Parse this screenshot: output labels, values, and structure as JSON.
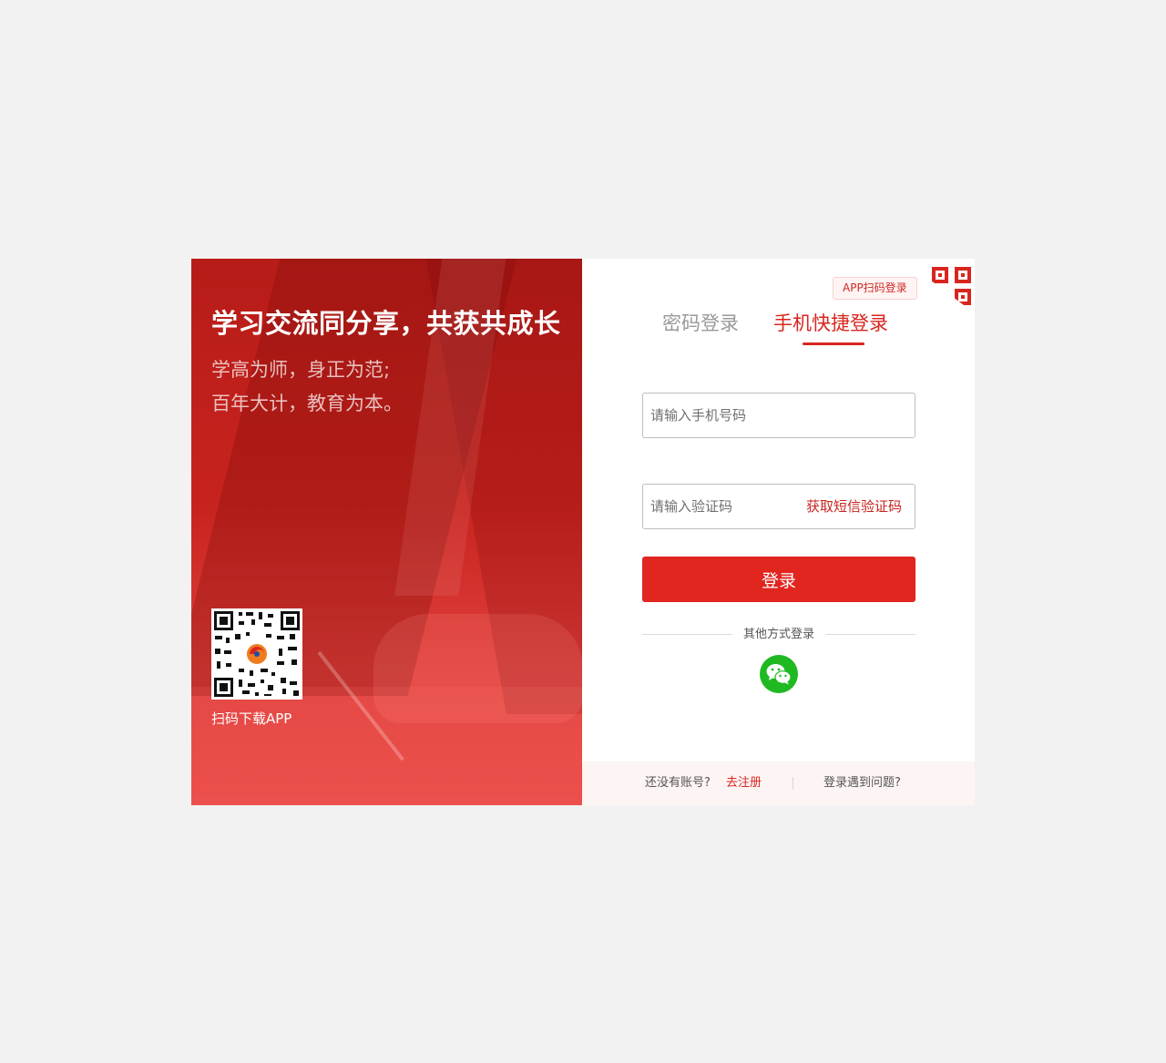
{
  "left_panel": {
    "slogan": "学习交流同分享，共获共成长",
    "motto_line1": "学高为师，身正为范;",
    "motto_line2": "百年大计，教育为本。",
    "qr_caption": "扫码下载APP"
  },
  "login": {
    "app_scan_label": "APP扫码登录",
    "tabs": [
      {
        "label": "密码登录",
        "active": false
      },
      {
        "label": "手机快捷登录",
        "active": true
      }
    ],
    "phone_placeholder": "请输入手机号码",
    "code_placeholder": "请输入验证码",
    "get_code_label": "获取短信验证码",
    "submit_label": "登录",
    "other_methods_label": "其他方式登录",
    "wechat_icon": "wechat-icon"
  },
  "footer": {
    "no_account_text": "还没有账号?",
    "register_label": "去注册",
    "problem_label": "登录遇到问题?"
  },
  "colors": {
    "brand_red": "#e1251f",
    "tab_active": "#d8261f",
    "wechat_green": "#1fb922",
    "page_bg": "#f2f2f2"
  }
}
